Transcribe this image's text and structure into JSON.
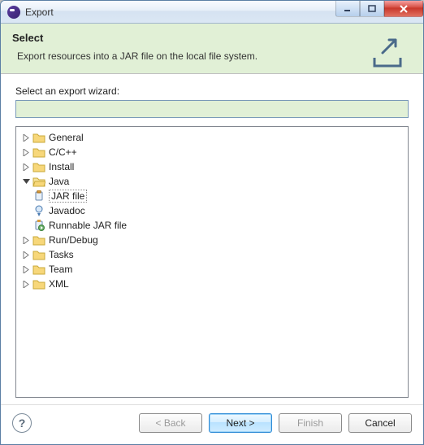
{
  "window": {
    "title": "Export"
  },
  "banner": {
    "title": "Select",
    "description": "Export resources into a JAR file on the local file system."
  },
  "content": {
    "prompt": "Select an export wizard:",
    "filter_value": ""
  },
  "tree": {
    "nodes": [
      {
        "label": "General",
        "expanded": false,
        "icon": "folder"
      },
      {
        "label": "C/C++",
        "expanded": false,
        "icon": "folder"
      },
      {
        "label": "Install",
        "expanded": false,
        "icon": "folder"
      },
      {
        "label": "Java",
        "expanded": true,
        "icon": "folder-open",
        "children": [
          {
            "label": "JAR file",
            "icon": "jar",
            "selected": true
          },
          {
            "label": "Javadoc",
            "icon": "javadoc"
          },
          {
            "label": "Runnable JAR file",
            "icon": "runjar"
          }
        ]
      },
      {
        "label": "Run/Debug",
        "expanded": false,
        "icon": "folder"
      },
      {
        "label": "Tasks",
        "expanded": false,
        "icon": "folder"
      },
      {
        "label": "Team",
        "expanded": false,
        "icon": "folder"
      },
      {
        "label": "XML",
        "expanded": false,
        "icon": "folder"
      }
    ]
  },
  "buttons": {
    "back": "< Back",
    "next": "Next >",
    "finish": "Finish",
    "cancel": "Cancel",
    "help": "?"
  }
}
